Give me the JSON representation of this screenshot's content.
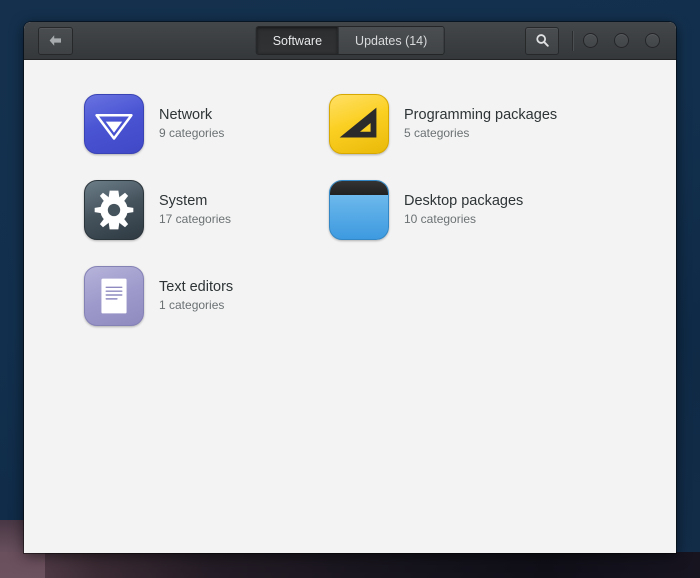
{
  "window": {
    "header": {
      "back_button": {
        "name": "back-button",
        "icon": "arrow-left-icon",
        "label": ""
      },
      "tabs": [
        {
          "label": "Software",
          "active": true
        },
        {
          "label": "Updates (14)",
          "active": false
        }
      ],
      "search_button": {
        "icon": "search-icon",
        "label": ""
      },
      "window_controls": [
        {
          "name": "minimize-button"
        },
        {
          "name": "maximize-button"
        },
        {
          "name": "close-button"
        }
      ]
    },
    "content": {
      "categories": [
        {
          "title": "Network",
          "subtitle": "9 categories",
          "icon": "network-icon",
          "icon_class": "icon-network",
          "color": "#4a55d4"
        },
        {
          "title": "Programming packages",
          "subtitle": "5 categories",
          "icon": "set-square-icon",
          "icon_class": "icon-programming",
          "color": "#fbd023"
        },
        {
          "title": "System",
          "subtitle": "17 categories",
          "icon": "gear-icon",
          "icon_class": "icon-system",
          "color": "#45535d"
        },
        {
          "title": "Desktop packages",
          "subtitle": "10 categories",
          "icon": "window-icon",
          "icon_class": "icon-desktop",
          "color": "#5fb0e8"
        },
        {
          "title": "Text editors",
          "subtitle": "1 categories",
          "icon": "document-icon",
          "icon_class": "icon-texteditors",
          "color": "#9e9acb"
        }
      ]
    }
  },
  "theme": {
    "headerbar_bg": "#3c3f42",
    "content_bg": "#f3f3f3",
    "desktop_bg": "#12304e",
    "title_color": "#2e3436",
    "subtitle_color": "#6b7173"
  }
}
